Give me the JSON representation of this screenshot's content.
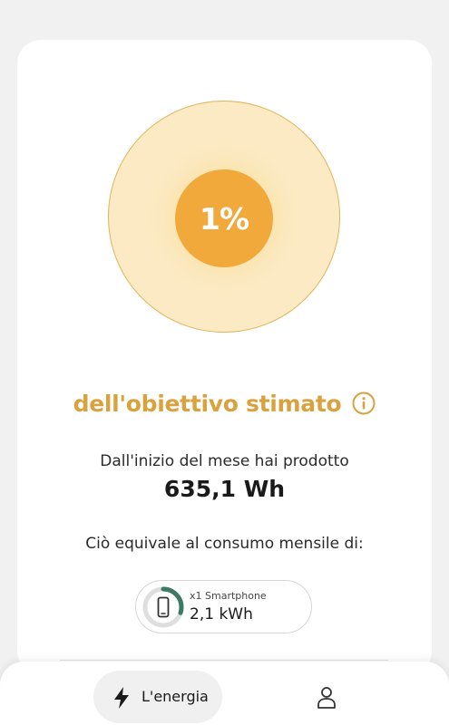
{
  "goal": {
    "percent_label": "1%",
    "percent_value": 1,
    "label": "dell'obiettivo stimato",
    "info_icon": "info-circle-icon"
  },
  "production": {
    "text": "Dall'inizio del mese hai prodotto",
    "value": "635,1 Wh"
  },
  "equivalence": {
    "text": "Ciò equivale al consumo mensile di:",
    "device": {
      "icon": "smartphone-icon",
      "count_label": "x1 Smartphone",
      "energy": "2,1 kWh",
      "gauge_fraction": 0.3
    }
  },
  "nav": {
    "energy_label": "L'energia",
    "energy_icon": "lightning-bolt-icon",
    "profile_icon": "user-icon"
  },
  "colors": {
    "accent": "#f2a93b",
    "accent_label": "#d9a23f",
    "halo": "#fbeac3",
    "gauge": "#3d7a66"
  }
}
